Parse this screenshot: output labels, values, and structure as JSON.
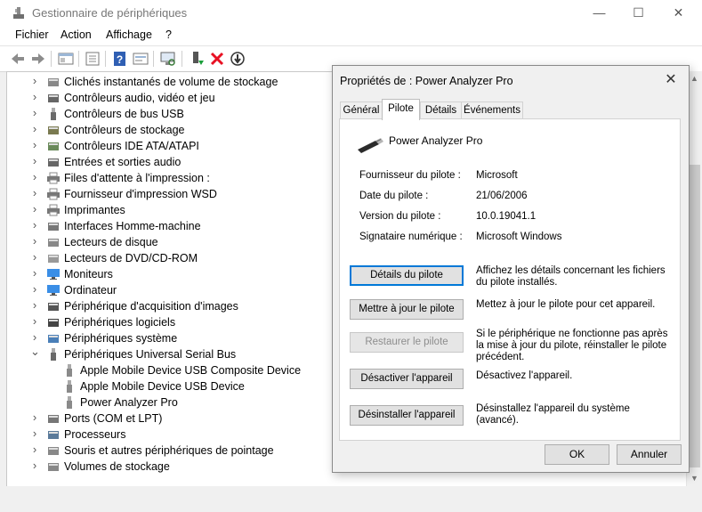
{
  "window": {
    "title": "Gestionnaire de périphériques",
    "minimize": "—",
    "maximize": "☐",
    "close": "✕"
  },
  "menu": [
    "Fichier",
    "Action",
    "Affichage",
    "?"
  ],
  "toolbar_icons": [
    "back-arrow-icon",
    "forward-arrow-icon",
    "device-view-icon",
    "properties-icon",
    "help-icon",
    "resources-view-icon",
    "scan-hardware-icon",
    "enable-device-icon",
    "uninstall-icon",
    "update-driver-icon"
  ],
  "tree": {
    "items": [
      {
        "label": "Clichés instantanés de volume de stockage",
        "icon": "storage-volume-shadow-icon",
        "expanded": false
      },
      {
        "label": "Contrôleurs audio, vidéo et jeu",
        "icon": "audio-icon",
        "expanded": false
      },
      {
        "label": "Contrôleurs de bus USB",
        "icon": "usb-icon",
        "expanded": false
      },
      {
        "label": "Contrôleurs de stockage",
        "icon": "storage-controller-icon",
        "expanded": false
      },
      {
        "label": "Contrôleurs IDE ATA/ATAPI",
        "icon": "ide-icon",
        "expanded": false
      },
      {
        "label": "Entrées et sorties audio",
        "icon": "audio-io-icon",
        "expanded": false
      },
      {
        "label": "Files d'attente à l'impression :",
        "icon": "print-queue-icon",
        "expanded": false
      },
      {
        "label": "Fournisseur d'impression WSD",
        "icon": "wsd-printer-icon",
        "expanded": false
      },
      {
        "label": "Imprimantes",
        "icon": "printer-icon",
        "expanded": false
      },
      {
        "label": "Interfaces Homme-machine",
        "icon": "hid-icon",
        "expanded": false
      },
      {
        "label": "Lecteurs de disque",
        "icon": "disk-drive-icon",
        "expanded": false
      },
      {
        "label": "Lecteurs de DVD/CD-ROM",
        "icon": "dvd-icon",
        "expanded": false
      },
      {
        "label": "Moniteurs",
        "icon": "monitor-icon",
        "expanded": false
      },
      {
        "label": "Ordinateur",
        "icon": "computer-icon",
        "expanded": false
      },
      {
        "label": "Périphérique d'acquisition d'images",
        "icon": "camera-icon",
        "expanded": false
      },
      {
        "label": "Périphériques logiciels",
        "icon": "software-device-icon",
        "expanded": false
      },
      {
        "label": "Périphériques système",
        "icon": "system-device-icon",
        "expanded": false
      },
      {
        "label": "Périphériques Universal Serial Bus",
        "icon": "usb-icon",
        "expanded": true
      },
      {
        "label": "Apple Mobile Device USB Composite Device",
        "icon": "usb-device-icon",
        "child": true
      },
      {
        "label": "Apple Mobile Device USB Device",
        "icon": "usb-device-icon",
        "child": true
      },
      {
        "label": "Power Analyzer Pro",
        "icon": "usb-device-icon",
        "child": true
      },
      {
        "label": "Ports (COM et LPT)",
        "icon": "port-icon",
        "expanded": false
      },
      {
        "label": "Processeurs",
        "icon": "processor-icon",
        "expanded": false
      },
      {
        "label": "Souris et autres périphériques de pointage",
        "icon": "mouse-icon",
        "expanded": false
      },
      {
        "label": "Volumes de stockage",
        "icon": "storage-volume-icon",
        "expanded": false
      }
    ]
  },
  "dialog": {
    "title": "Propriétés de : Power Analyzer Pro",
    "close": "✕",
    "tabs": [
      "Général",
      "Pilote",
      "Détails",
      "Événements"
    ],
    "active_tab": "Pilote",
    "device_name": "Power Analyzer Pro",
    "props": [
      {
        "label": "Fournisseur du pilote :",
        "value": "Microsoft"
      },
      {
        "label": "Date du pilote :",
        "value": "21/06/2006"
      },
      {
        "label": "Version du pilote :",
        "value": "10.0.19041.1"
      },
      {
        "label": "Signataire numérique :",
        "value": "Microsoft Windows"
      }
    ],
    "actions": [
      {
        "label": "Détails du pilote",
        "desc": "Affichez les détails concernant les fichiers du pilote installés.",
        "enabled": true,
        "focused": true
      },
      {
        "label": "Mettre à jour le pilote",
        "desc": "Mettez à jour le pilote pour cet appareil.",
        "enabled": true
      },
      {
        "label": "Restaurer le pilote",
        "desc": "Si le périphérique ne fonctionne pas après la mise à jour du pilote, réinstaller le pilote précédent.",
        "enabled": false
      },
      {
        "label": "Désactiver l'appareil",
        "desc": "Désactivez l'appareil.",
        "enabled": true
      },
      {
        "label": "Désinstaller l'appareil",
        "desc": "Désinstallez l'appareil du système (avancé).",
        "enabled": true
      }
    ],
    "ok": "OK",
    "cancel": "Annuler"
  },
  "colors": {
    "accent": "#0078d7",
    "remove_red": "#e81123",
    "enable_green": "#1a9e3a"
  }
}
